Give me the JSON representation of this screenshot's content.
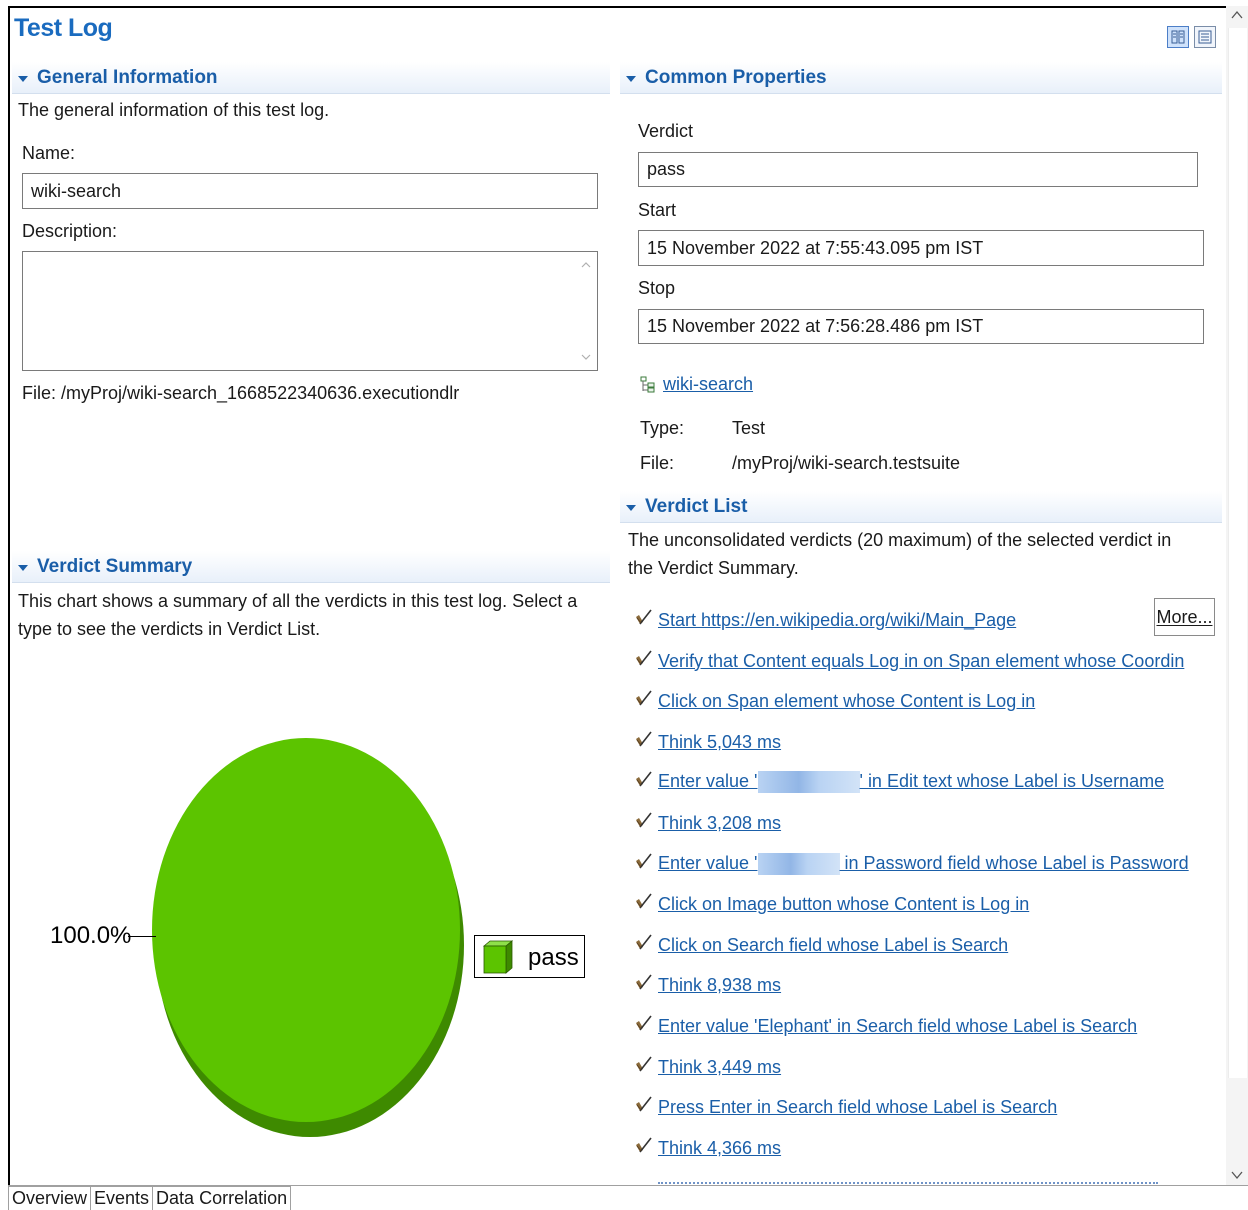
{
  "page": {
    "title": "Test Log"
  },
  "general": {
    "header": "General Information",
    "description": "The general information of this test log.",
    "name_label": "Name:",
    "name_value": "wiki-search",
    "desc_label": "Description:",
    "desc_value": "",
    "file_text": "File:  /myProj/wiki-search_1668522340636.executiondlr"
  },
  "common": {
    "header": "Common Properties",
    "verdict_label": "Verdict",
    "verdict_value": "pass",
    "start_label": "Start",
    "start_value": "15 November 2022 at 7:55:43.095 pm IST",
    "stop_label": "Stop",
    "stop_value": "15 November 2022 at 7:56:28.486 pm IST",
    "suite_link": "wiki-search",
    "type_label": "Type:",
    "type_value": "Test",
    "file_label": "File:",
    "file_value": "/myProj/wiki-search.testsuite"
  },
  "summary": {
    "header": "Verdict Summary",
    "description": "This chart shows a summary of all the verdicts in this test log. Select a type to see the verdicts in Verdict List."
  },
  "chart_data": {
    "type": "pie",
    "categories": [
      "pass"
    ],
    "values": [
      100.0
    ],
    "labels": [
      "100.0%"
    ],
    "legend": [
      "pass"
    ],
    "colors": [
      "#5cc400"
    ],
    "legend_placement": "right"
  },
  "verdict_list": {
    "header": "Verdict List",
    "description": "The unconsolidated verdicts (20 maximum) of the selected verdict in the Verdict Summary.",
    "more_label": "More...",
    "items": [
      {
        "text": "Start https://en.wikipedia.org/wiki/Main_Page"
      },
      {
        "text": "Verify that Content equals Log in on Span element whose Coordin"
      },
      {
        "text": "Click on Span element whose Content is Log in"
      },
      {
        "text": "Think 5,043 ms"
      },
      {
        "pre": "Enter value '",
        "post": "' in Edit text whose Label is Username"
      },
      {
        "text": "Think 3,208 ms"
      },
      {
        "pre": "Enter value '",
        "post": " in Password field whose Label is Password"
      },
      {
        "text": "Click on Image button whose Content is Log in"
      },
      {
        "text": "Click on Search field whose Label is Search"
      },
      {
        "text": "Think 8,938 ms"
      },
      {
        "text": "Enter value 'Elephant' in Search field whose Label is Search"
      },
      {
        "text": "Think 3,449 ms"
      },
      {
        "text": "Press Enter in Search field whose Label is Search"
      },
      {
        "text": "Think 4,366 ms"
      }
    ]
  },
  "tabs": [
    {
      "label": "Overview"
    },
    {
      "label": "Events"
    },
    {
      "label": "Data Correlation"
    }
  ]
}
